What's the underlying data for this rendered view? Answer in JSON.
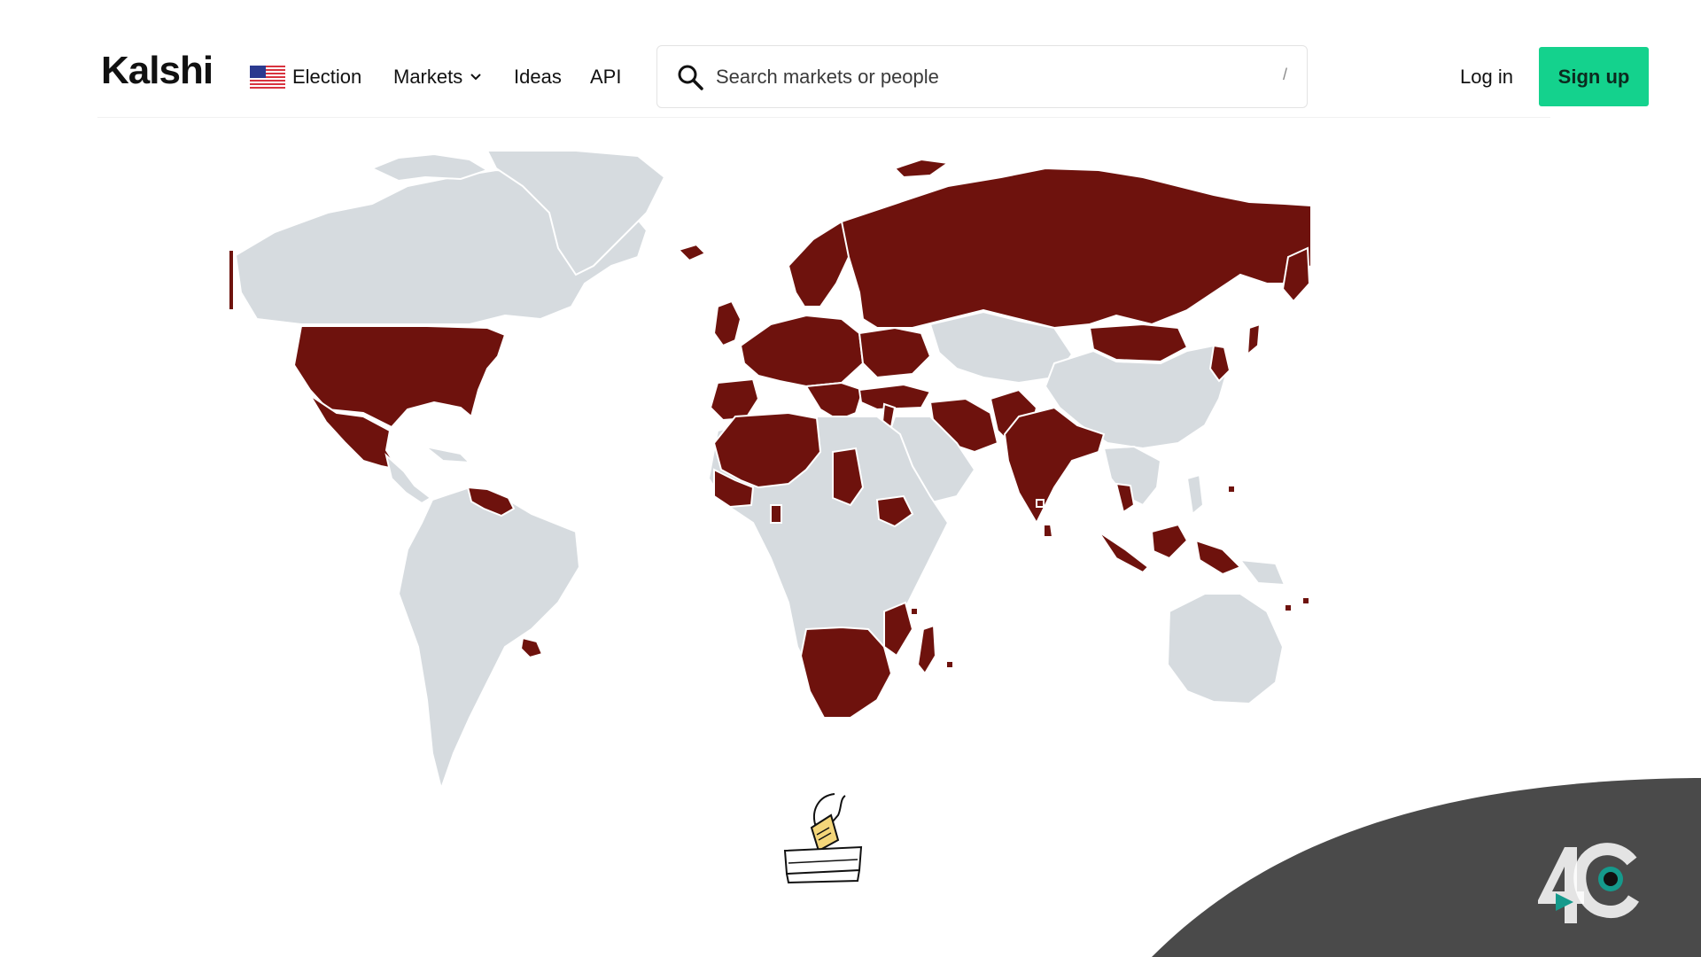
{
  "header": {
    "logo": "Kalshi",
    "nav": [
      {
        "label": "Election",
        "icon": "us-flag-icon"
      },
      {
        "label": "Markets",
        "icon": "chevron-down-icon"
      },
      {
        "label": "Ideas"
      },
      {
        "label": "API"
      }
    ],
    "search": {
      "placeholder": "Search markets or people",
      "shortcut": "/"
    },
    "login_label": "Log in",
    "signup_label": "Sign up"
  },
  "map": {
    "type": "world-choropleth",
    "highlight_color": "#6e120d",
    "base_color": "#d6dbdf"
  },
  "colors": {
    "signup_button": "#14d28d",
    "corner_shape": "#4a4a4a",
    "logo_accent": "#159a8c"
  },
  "icons": [
    "us-flag-icon",
    "chevron-down-icon",
    "search-icon",
    "ballot-box-icon",
    "channel-logo-icon"
  ]
}
